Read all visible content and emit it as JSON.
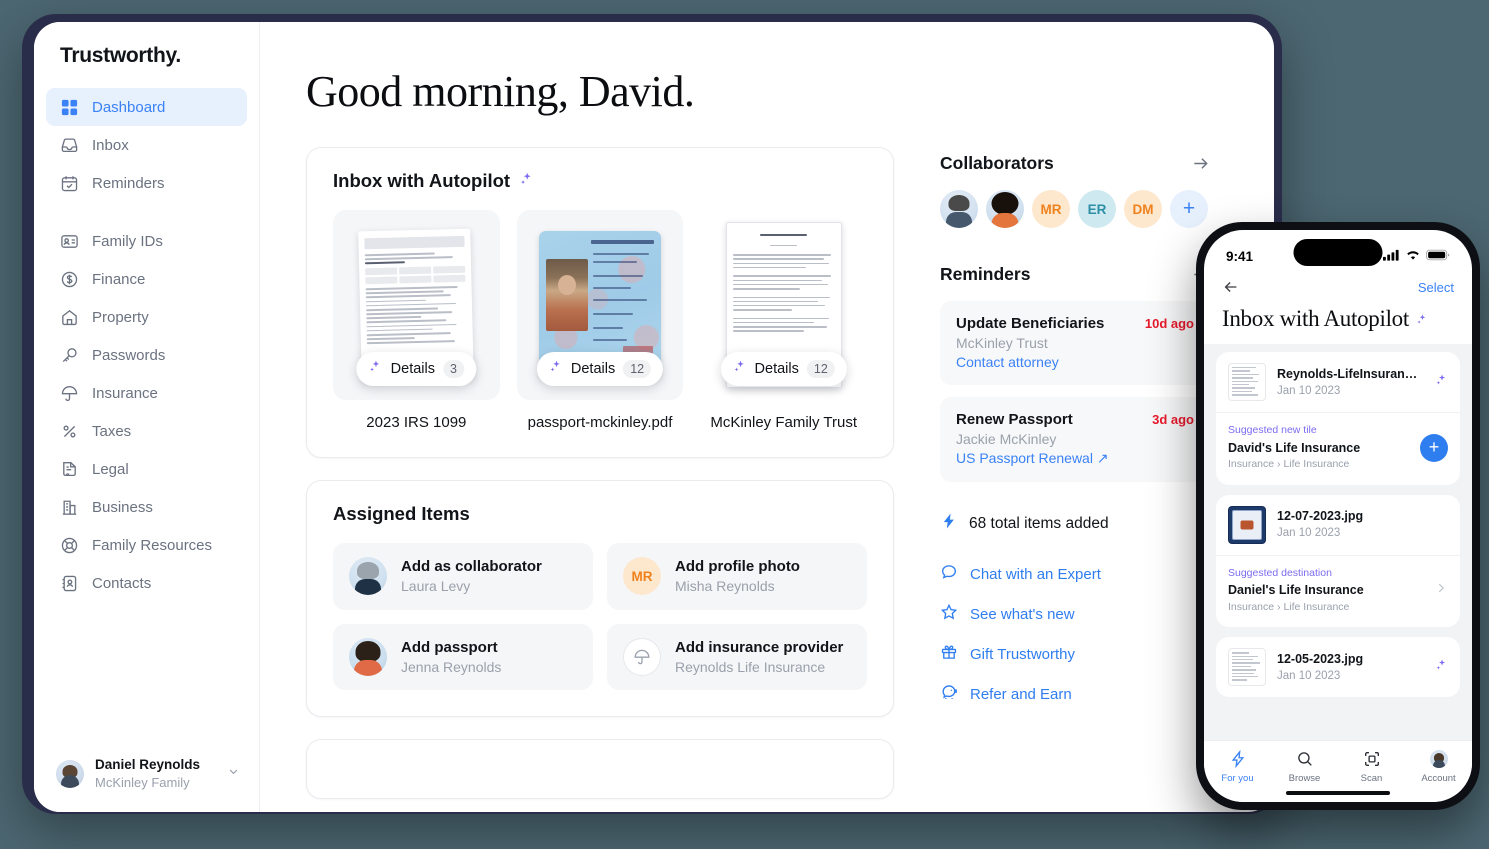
{
  "colors": {
    "page_background": "#4c6772",
    "window_bezel": "#2a2d4a",
    "accent_blue": "#3b82f6",
    "link_blue": "#2f7ef0",
    "alert_red": "#e8192c",
    "sparkle_purple": "#7c6cf0",
    "avatar_orange": "#f0821e",
    "avatar_teal": "#2c8fa6"
  },
  "sidebar": {
    "brand": "Trustworthy.",
    "items": [
      {
        "label": "Dashboard",
        "icon": "grid-icon",
        "active": true
      },
      {
        "label": "Inbox",
        "icon": "inbox-icon",
        "active": false
      },
      {
        "label": "Reminders",
        "icon": "calendar-check-icon",
        "active": false
      },
      {
        "label": "Family IDs",
        "icon": "id-card-icon",
        "active": false
      },
      {
        "label": "Finance",
        "icon": "dollar-circle-icon",
        "active": false
      },
      {
        "label": "Property",
        "icon": "home-icon",
        "active": false
      },
      {
        "label": "Passwords",
        "icon": "key-icon",
        "active": false
      },
      {
        "label": "Insurance",
        "icon": "umbrella-icon",
        "active": false
      },
      {
        "label": "Taxes",
        "icon": "percent-icon",
        "active": false
      },
      {
        "label": "Legal",
        "icon": "legal-document-icon",
        "active": false
      },
      {
        "label": "Business",
        "icon": "building-icon",
        "active": false
      },
      {
        "label": "Family Resources",
        "icon": "lifebuoy-icon",
        "active": false
      },
      {
        "label": "Contacts",
        "icon": "contact-book-icon",
        "active": false
      }
    ],
    "user": {
      "name": "Daniel Reynolds",
      "family": "McKinley Family",
      "chevron": "chevron-down-icon"
    }
  },
  "main": {
    "greeting": "Good morning, David.",
    "inbox_card": {
      "title": "Inbox with Autopilot",
      "sparkle": "sparkle-icon",
      "tiles": [
        {
          "name": "2023 IRS 1099",
          "details_label": "Details",
          "count": "3",
          "art": "tax-form-document"
        },
        {
          "name": "passport-mckinley.pdf",
          "details_label": "Details",
          "count": "12",
          "art": "passport-photo-page"
        },
        {
          "name": "McKinley Family Trust",
          "details_label": "Details",
          "count": "12",
          "art": "legal-trust-document"
        }
      ]
    },
    "assigned_card": {
      "title": "Assigned Items",
      "items": [
        {
          "title": "Add as collaborator",
          "subtitle": "Laura Levy",
          "avatar": "photo-laura"
        },
        {
          "title": "Add profile photo",
          "subtitle": "Misha Reynolds",
          "avatar": "initials-MR",
          "initials": "MR"
        },
        {
          "title": "Add passport",
          "subtitle": "Jenna Reynolds",
          "avatar": "photo-jenna"
        },
        {
          "title": "Add insurance provider",
          "subtitle": "Reynolds Life Insurance",
          "avatar": "umbrella-icon"
        }
      ]
    }
  },
  "right": {
    "collaborators": {
      "title": "Collaborators",
      "arrow": "arrow-right-icon",
      "avatars": [
        {
          "type": "photo",
          "name": "collaborator-photo-1"
        },
        {
          "type": "photo",
          "name": "collaborator-photo-2"
        },
        {
          "type": "initials",
          "initials": "MR"
        },
        {
          "type": "initials",
          "initials": "ER"
        },
        {
          "type": "initials",
          "initials": "DM"
        },
        {
          "type": "add",
          "label": "+"
        }
      ]
    },
    "reminders": {
      "title": "Reminders",
      "arrow": "arrow-right-icon",
      "items": [
        {
          "title": "Update Beneficiaries",
          "subtitle": "McKinley Trust",
          "link": "Contact attorney",
          "ago": "10d ago",
          "external": false
        },
        {
          "title": "Renew Passport",
          "subtitle": "Jackie McKinley",
          "link": "US Passport Renewal",
          "ago": "3d ago",
          "external": true
        }
      ]
    },
    "total_items": "68 total items added",
    "total_icon": "bolt-icon",
    "quick_links": [
      {
        "label": "Chat with an Expert",
        "icon": "chat-bubble-icon"
      },
      {
        "label": "See what's new",
        "icon": "star-icon"
      },
      {
        "label": "Gift Trustworthy",
        "icon": "gift-icon"
      },
      {
        "label": "Refer and Earn",
        "icon": "piggy-bank-icon"
      }
    ]
  },
  "phone": {
    "status": {
      "time": "9:41",
      "cellular": "signal-bars-icon",
      "wifi": "wifi-icon",
      "battery": "battery-icon"
    },
    "nav": {
      "back": "back-arrow-icon",
      "select": "Select"
    },
    "title": "Inbox with Autopilot",
    "title_sparkle": "sparkle-icon",
    "cards": [
      {
        "file": "Reynolds-LifeInsurance.pdf",
        "date": "Jan 10 2023",
        "thumb": "document-thumbnail",
        "row_action": "sparkle-icon",
        "suggestion": {
          "label": "Suggested new tile",
          "name": "David's Life Insurance",
          "path": "Insurance › Life Insurance",
          "action": "plus-button"
        }
      },
      {
        "file": "12-07-2023.jpg",
        "date": "Jan 10 2023",
        "thumb": "certificate-thumbnail",
        "row_action": "",
        "suggestion": {
          "label": "Suggested destination",
          "name": "Daniel's Life Insurance",
          "path": "Insurance › Life Insurance",
          "action": "chevron-right"
        }
      },
      {
        "file": "12-05-2023.jpg",
        "date": "Jan 10 2023",
        "thumb": "document-thumbnail",
        "row_action": "sparkle-icon",
        "suggestion": null
      }
    ],
    "tabs": [
      {
        "label": "For you",
        "icon": "bolt-icon",
        "active": true
      },
      {
        "label": "Browse",
        "icon": "search-icon",
        "active": false
      },
      {
        "label": "Scan",
        "icon": "scan-icon",
        "active": false
      },
      {
        "label": "Account",
        "icon": "avatar-icon",
        "active": false
      }
    ]
  }
}
